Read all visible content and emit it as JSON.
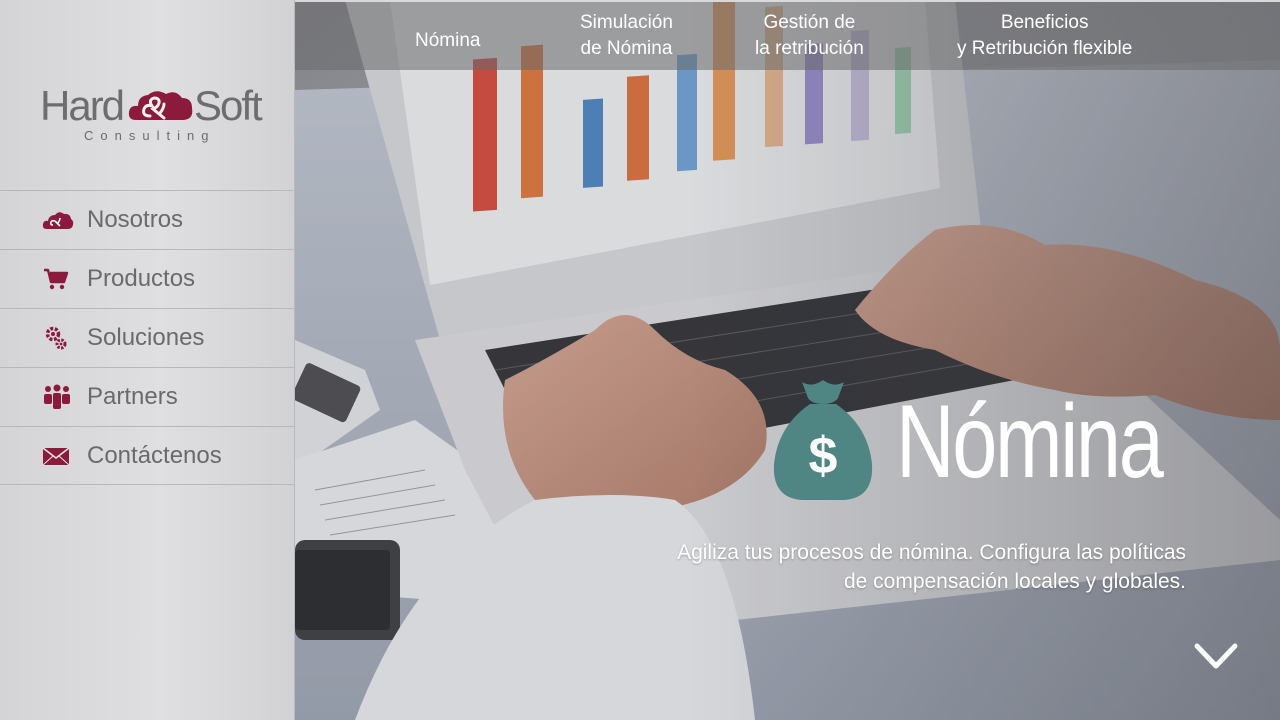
{
  "brand": {
    "name_left": "Hard",
    "name_right": "Soft",
    "tagline": "Consulting",
    "accent_color": "#8b1a3d"
  },
  "sidebar": {
    "items": [
      {
        "label": "Nosotros",
        "icon": "cloud-icon"
      },
      {
        "label": "Productos",
        "icon": "cart-icon"
      },
      {
        "label": "Soluciones",
        "icon": "gears-icon"
      },
      {
        "label": "Partners",
        "icon": "people-icon"
      },
      {
        "label": "Contáctenos",
        "icon": "envelope-icon"
      }
    ]
  },
  "topnav": {
    "items": [
      {
        "line1": "Nómina",
        "line2": ""
      },
      {
        "line1": "Simulación",
        "line2": "de Nómina"
      },
      {
        "line1": "Gestión de",
        "line2": "la retribución"
      },
      {
        "line1": "Beneficios",
        "line2": "y Retribución flexible"
      }
    ]
  },
  "hero": {
    "title": "Nómina",
    "icon": "money-bag-icon",
    "icon_symbol": "$",
    "icon_color": "#4f8583",
    "description": "Agiliza tus procesos de nómina. Configura las políticas de compensación locales y globales.",
    "scroll_icon": "chevron-down-icon"
  }
}
